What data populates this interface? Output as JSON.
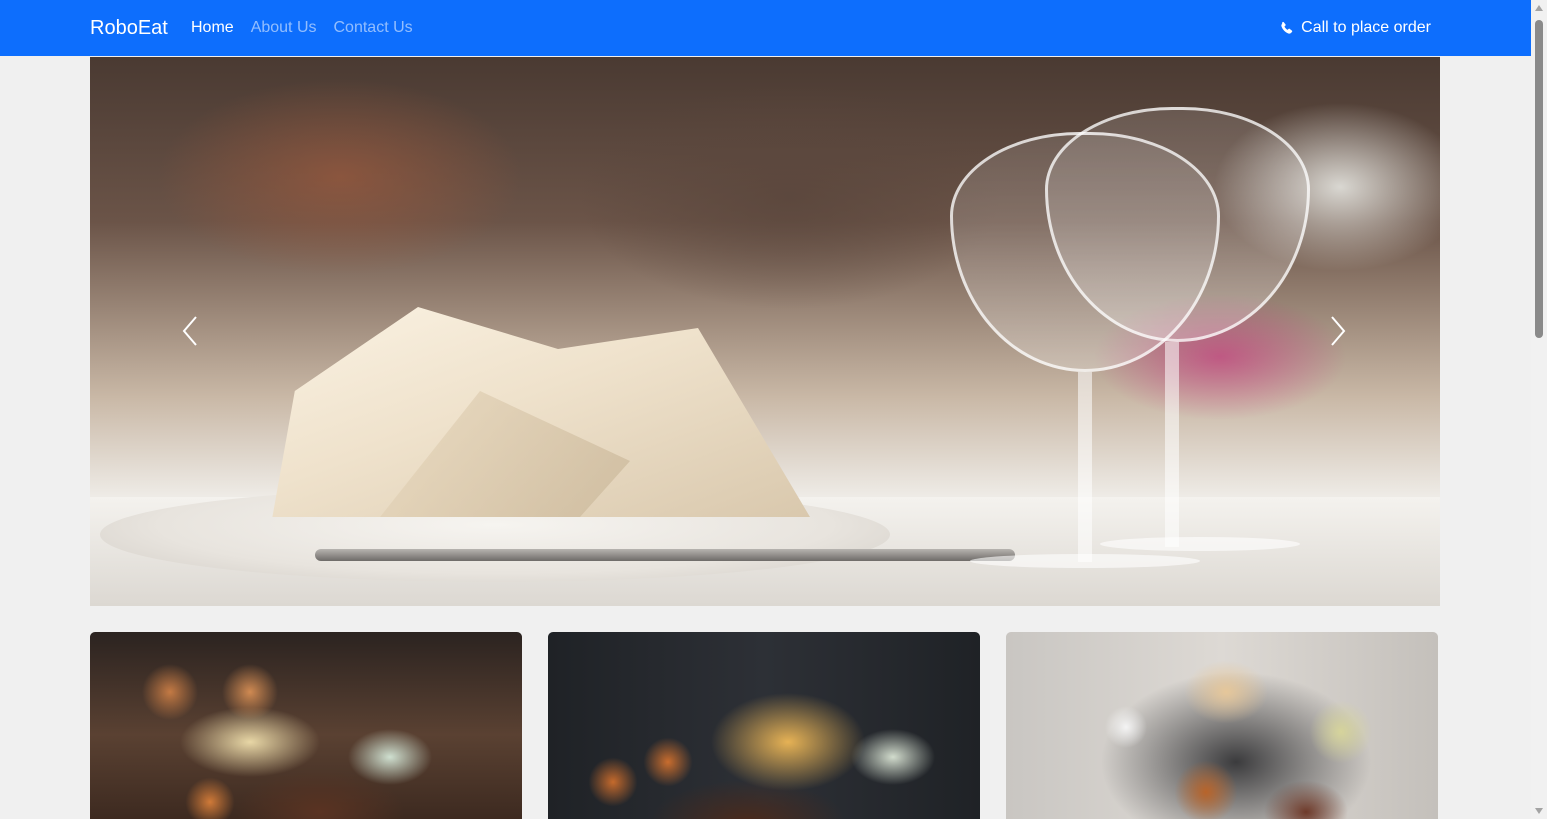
{
  "navbar": {
    "brand": "RoboEat",
    "links": [
      {
        "label": "Home",
        "active": true
      },
      {
        "label": "About Us",
        "active": false
      },
      {
        "label": "Contact Us",
        "active": false
      }
    ],
    "call_label": "Call to place order",
    "call_icon": "phone-icon",
    "background_color": "#0d6efd"
  },
  "carousel": {
    "prev_icon": "chevron-left-icon",
    "next_icon": "chevron-right-icon"
  },
  "cards": [
    {
      "image": "food-platter-with-onion-rings-and-coleslaw"
    },
    {
      "image": "steak-with-fries-and-coleslaw"
    },
    {
      "image": "steak-with-baked-potato-and-onion-rings"
    }
  ]
}
